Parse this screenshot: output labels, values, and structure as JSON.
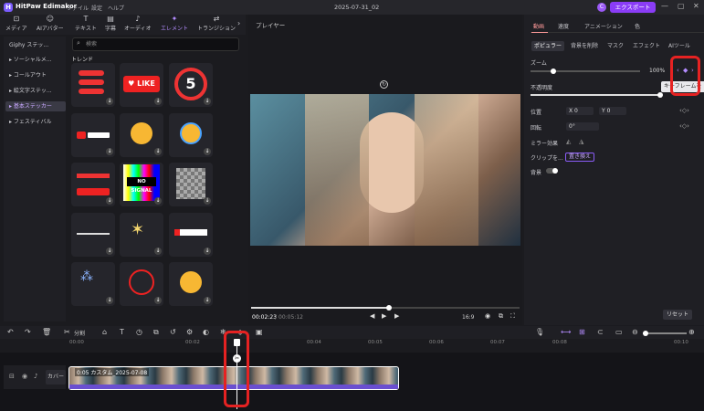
{
  "app": {
    "name": "HitPaw Edimakor",
    "logo_letter": "H",
    "menu": [
      "ファイル",
      "設定",
      "ヘルプ"
    ],
    "doc_title": "2025-07-31_02",
    "avatar": "C",
    "export_label": "エクスポート",
    "window": [
      "—",
      "▢",
      "✕"
    ]
  },
  "toolbar": [
    {
      "label": "メディア",
      "icon": "media-icon"
    },
    {
      "label": "AIアバター",
      "icon": "avatar-icon"
    },
    {
      "label": "テキスト",
      "icon": "text-icon"
    },
    {
      "label": "字幕",
      "icon": "subtitle-icon"
    },
    {
      "label": "オーディオ",
      "icon": "audio-icon"
    },
    {
      "label": "エレメント",
      "icon": "element-icon",
      "active": true
    },
    {
      "label": "トランジション",
      "icon": "transition-icon"
    }
  ],
  "sidebar": [
    "Giphy ステッ...",
    "ソーシャルメ...",
    "コールアウト",
    "絵文字ステッ...",
    "基本ステッカー",
    "フェスティバル"
  ],
  "sidebar_selected": 4,
  "search": {
    "placeholder": "検索"
  },
  "trend_label": "トレンド",
  "player": {
    "label": "プレイヤー",
    "time_current": "00:02:23",
    "time_total": "00:05:12",
    "ratio": "16:9"
  },
  "props": {
    "tabs": [
      "動画",
      "速度",
      "アニメーション",
      "色"
    ],
    "subtabs": [
      "ポピュラー",
      "背景を削除",
      "マスク",
      "エフェクト",
      "AIツール"
    ],
    "zoom_label": "ズーム",
    "zoom_value": "100%",
    "zoom_level": 0.05,
    "opacity_label": "不透明度",
    "opacity_level": 1.0,
    "tooltip": "キーフレームを",
    "position_label": "位置",
    "pos_x_label": "X",
    "pos_x": "0",
    "pos_y_label": "Y",
    "pos_y": "0",
    "rotate_label": "回転",
    "rotate_value": "0°",
    "mirror_label": "ミラー効果",
    "clip_label": "クリップを...",
    "replace_label": "置き換え",
    "bg_label": "背景",
    "reset_label": "リセット"
  },
  "timeline": {
    "split_label": "分割",
    "ruler": [
      "00:00",
      "00:02",
      "00:04",
      "00:05",
      "00:06",
      "00:07",
      "00:08",
      "00:10"
    ],
    "cover_label": "カバー",
    "clip_label": "0:05 カスタム_2025-07-08"
  },
  "colors": {
    "accent": "#8a3cf6",
    "highlight": "#e52222",
    "active_tab": "#ff9a9a"
  }
}
